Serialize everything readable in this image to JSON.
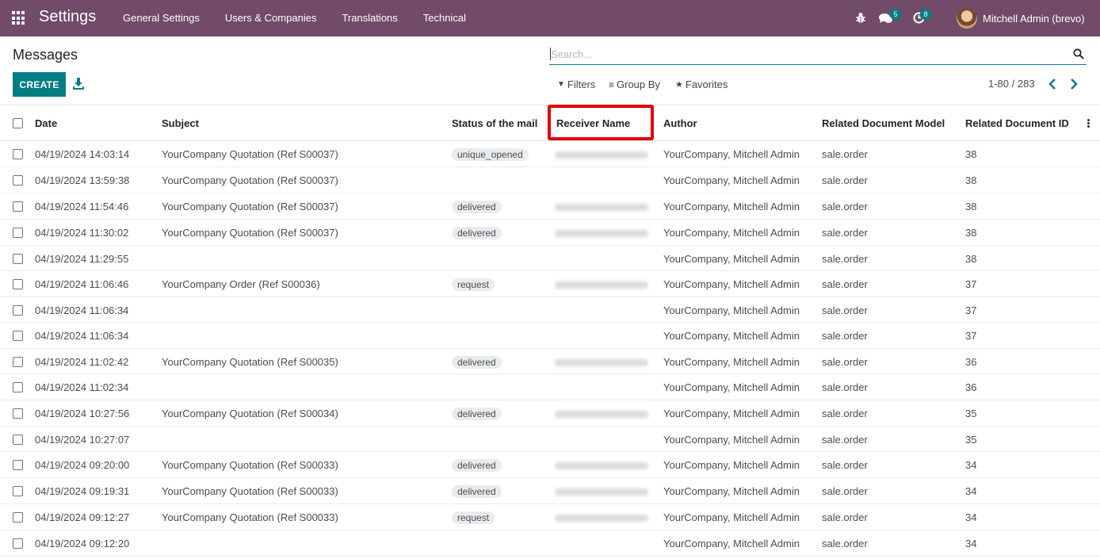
{
  "navbar": {
    "app_title": "Settings",
    "menu": [
      "General Settings",
      "Users & Companies",
      "Translations",
      "Technical"
    ],
    "chat_count": "5",
    "activity_count": "8",
    "user_name": "Mitchell Admin (brevo)"
  },
  "control_panel": {
    "breadcrumb": "Messages",
    "create_label": "CREATE",
    "search_placeholder": "Search...",
    "filters_label": "Filters",
    "groupby_label": "Group By",
    "favorites_label": "Favorites",
    "pager": "1-80 / 283"
  },
  "table": {
    "columns": [
      "Date",
      "Subject",
      "Status of the mail",
      "Receiver Name",
      "Author",
      "Related Document Model",
      "Related Document ID"
    ],
    "rows": [
      {
        "date": "04/19/2024 14:03:14",
        "subject": "YourCompany Quotation (Ref S00037)",
        "status": "unique_opened",
        "receiver": "blurred",
        "author": "YourCompany, Mitchell Admin",
        "model": "sale.order",
        "res_id": "38"
      },
      {
        "date": "04/19/2024 13:59:38",
        "subject": "YourCompany Quotation (Ref S00037)",
        "status": "",
        "receiver": "",
        "author": "YourCompany, Mitchell Admin",
        "model": "sale.order",
        "res_id": "38"
      },
      {
        "date": "04/19/2024 11:54:46",
        "subject": "YourCompany Quotation (Ref S00037)",
        "status": "delivered",
        "receiver": "blurred",
        "author": "YourCompany, Mitchell Admin",
        "model": "sale.order",
        "res_id": "38"
      },
      {
        "date": "04/19/2024 11:30:02",
        "subject": "YourCompany Quotation (Ref S00037)",
        "status": "delivered",
        "receiver": "blurred",
        "author": "YourCompany, Mitchell Admin",
        "model": "sale.order",
        "res_id": "38"
      },
      {
        "date": "04/19/2024 11:29:55",
        "subject": "",
        "status": "",
        "receiver": "",
        "author": "YourCompany, Mitchell Admin",
        "model": "sale.order",
        "res_id": "38"
      },
      {
        "date": "04/19/2024 11:06:46",
        "subject": "YourCompany Order (Ref S00036)",
        "status": "request",
        "receiver": "blurred",
        "author": "YourCompany, Mitchell Admin",
        "model": "sale.order",
        "res_id": "37"
      },
      {
        "date": "04/19/2024 11:06:34",
        "subject": "",
        "status": "",
        "receiver": "",
        "author": "YourCompany, Mitchell Admin",
        "model": "sale.order",
        "res_id": "37"
      },
      {
        "date": "04/19/2024 11:06:34",
        "subject": "",
        "status": "",
        "receiver": "",
        "author": "YourCompany, Mitchell Admin",
        "model": "sale.order",
        "res_id": "37"
      },
      {
        "date": "04/19/2024 11:02:42",
        "subject": "YourCompany Quotation (Ref S00035)",
        "status": "delivered",
        "receiver": "blurred",
        "author": "YourCompany, Mitchell Admin",
        "model": "sale.order",
        "res_id": "36"
      },
      {
        "date": "04/19/2024 11:02:34",
        "subject": "",
        "status": "",
        "receiver": "",
        "author": "YourCompany, Mitchell Admin",
        "model": "sale.order",
        "res_id": "36"
      },
      {
        "date": "04/19/2024 10:27:56",
        "subject": "YourCompany Quotation (Ref S00034)",
        "status": "delivered",
        "receiver": "blurred",
        "author": "YourCompany, Mitchell Admin",
        "model": "sale.order",
        "res_id": "35"
      },
      {
        "date": "04/19/2024 10:27:07",
        "subject": "",
        "status": "",
        "receiver": "",
        "author": "YourCompany, Mitchell Admin",
        "model": "sale.order",
        "res_id": "35"
      },
      {
        "date": "04/19/2024 09:20:00",
        "subject": "YourCompany Quotation (Ref S00033)",
        "status": "delivered",
        "receiver": "blurred",
        "author": "YourCompany, Mitchell Admin",
        "model": "sale.order",
        "res_id": "34"
      },
      {
        "date": "04/19/2024 09:19:31",
        "subject": "YourCompany Quotation (Ref S00033)",
        "status": "delivered",
        "receiver": "blurred",
        "author": "YourCompany, Mitchell Admin",
        "model": "sale.order",
        "res_id": "34"
      },
      {
        "date": "04/19/2024 09:12:27",
        "subject": "YourCompany Quotation (Ref S00033)",
        "status": "request",
        "receiver": "blurred",
        "author": "YourCompany, Mitchell Admin",
        "model": "sale.order",
        "res_id": "34"
      },
      {
        "date": "04/19/2024 09:12:20",
        "subject": "",
        "status": "",
        "receiver": "",
        "author": "YourCompany, Mitchell Admin",
        "model": "sale.order",
        "res_id": "34"
      }
    ]
  },
  "colors": {
    "navbar": "#714b67",
    "primary": "#017e84",
    "highlight": "#e0000f"
  }
}
